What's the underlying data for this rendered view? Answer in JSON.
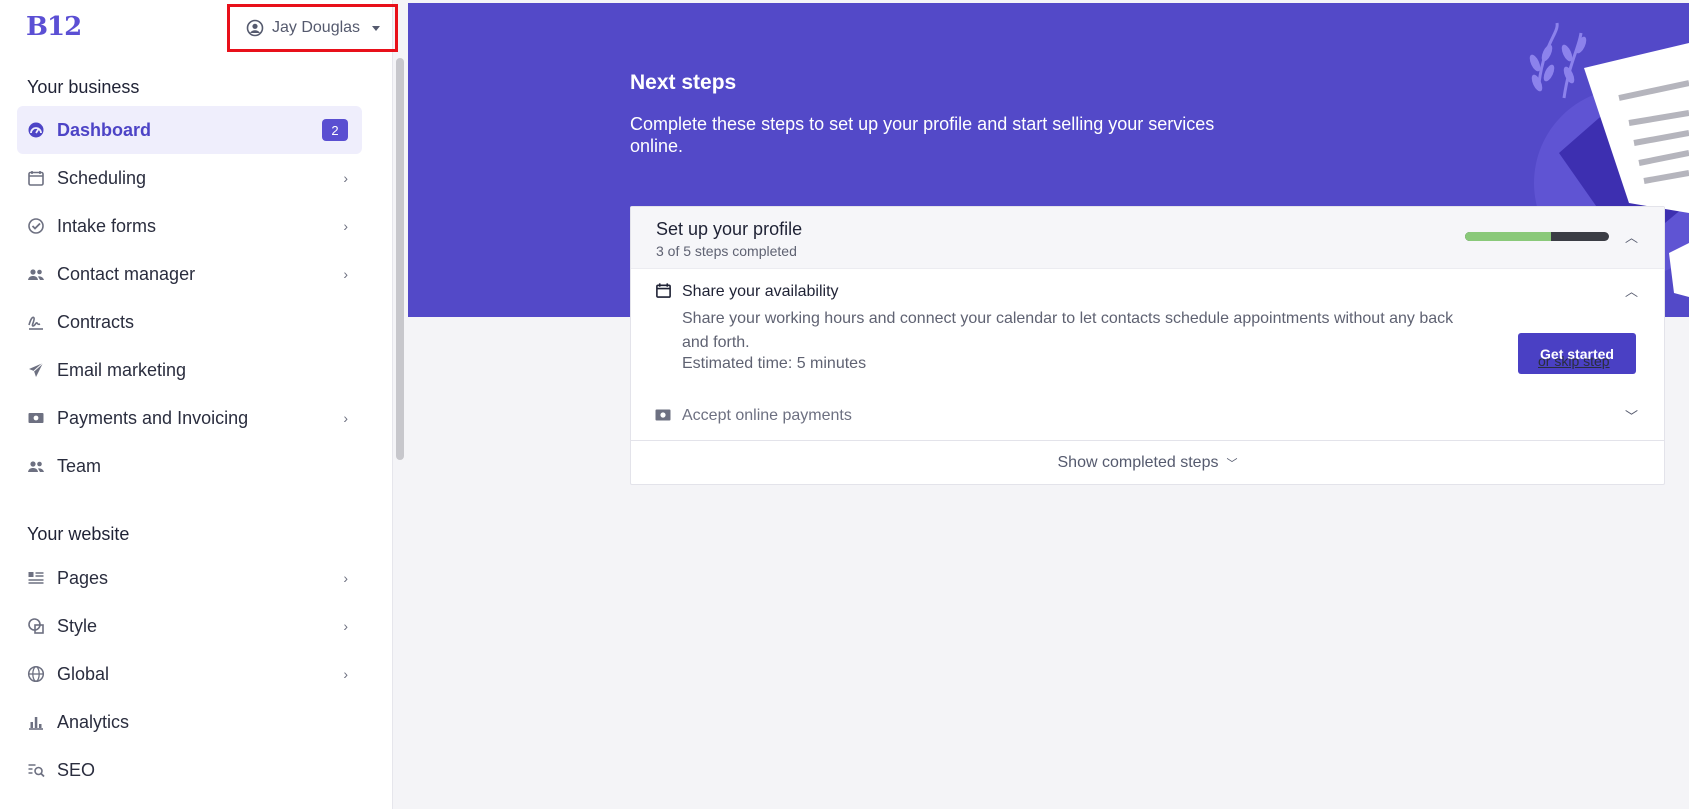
{
  "brand": {
    "logo_text": "B12"
  },
  "user_menu": {
    "name": "Jay Douglas",
    "icon": "user-circle-icon"
  },
  "sidebar": {
    "business_title": "Your business",
    "business_items": [
      {
        "label": "Dashboard",
        "icon": "dashboard-icon",
        "badge": "2",
        "active": true
      },
      {
        "label": "Scheduling",
        "icon": "calendar-icon",
        "chevron": true
      },
      {
        "label": "Intake forms",
        "icon": "check-circle-icon",
        "chevron": true
      },
      {
        "label": "Contact manager",
        "icon": "people-icon",
        "chevron": true
      },
      {
        "label": "Contracts",
        "icon": "signature-icon"
      },
      {
        "label": "Email marketing",
        "icon": "paper-plane-icon"
      },
      {
        "label": "Payments and Invoicing",
        "icon": "money-icon",
        "chevron": true
      },
      {
        "label": "Team",
        "icon": "team-icon"
      }
    ],
    "website_title": "Your website",
    "website_items": [
      {
        "label": "Pages",
        "icon": "pages-icon",
        "chevron": true
      },
      {
        "label": "Style",
        "icon": "style-icon",
        "chevron": true
      },
      {
        "label": "Global",
        "icon": "globe-icon",
        "chevron": true
      },
      {
        "label": "Analytics",
        "icon": "bar-chart-icon"
      },
      {
        "label": "SEO",
        "icon": "seo-icon"
      }
    ]
  },
  "hero": {
    "title": "Next steps",
    "subtitle": "Complete these steps to set up your profile and start selling your services online."
  },
  "profile_card": {
    "title": "Set up your profile",
    "subtitle": "3 of 5 steps completed",
    "progress": 0.6,
    "steps": [
      {
        "title": "Share your availability",
        "description": "Share your working hours and connect your calendar to let contacts schedule appointments without any back and forth.",
        "estimate": "Estimated time: 5 minutes",
        "primary_label": "Get started",
        "skip_label": "or skip step",
        "expanded": true
      },
      {
        "title": "Accept online payments",
        "expanded": false
      }
    ],
    "show_completed_label": "Show completed steps"
  },
  "colors": {
    "accent": "#5349C8",
    "progress_done": "#8AC97A",
    "progress_rest": "#3B3D45",
    "highlight_border": "#E8101A"
  }
}
